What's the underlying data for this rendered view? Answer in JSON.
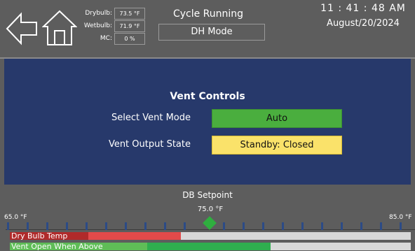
{
  "header": {
    "drybulb_label": "Drybulb:",
    "drybulb_value": "73.5 °F",
    "wetbulb_label": "Wetbulb:",
    "wetbulb_value": "71.9 °F",
    "mc_label": "MC:",
    "mc_value": "0 %",
    "status": "Cycle Running",
    "mode": "DH Mode",
    "time": "11 : 41 : 48  AM",
    "date": "August/20/2024",
    "icons": {
      "back": "back-arrow-icon",
      "home": "home-icon"
    }
  },
  "panel": {
    "title": "Vent Controls",
    "vent_mode_label": "Select Vent Mode",
    "vent_mode_value": "Auto",
    "vent_output_label": "Vent Output State",
    "vent_output_value": "Standby: Closed"
  },
  "setpoint": {
    "title": "DB Setpoint",
    "value": "75.0 °F",
    "scale_min": "65.0 °F",
    "scale_max": "85.0 °F",
    "bars": [
      {
        "label": "Dry Bulb Temp",
        "color": "#e24a4a"
      },
      {
        "label": "Vent Open When Above",
        "color": "#2fae4f"
      }
    ]
  },
  "colors": {
    "background": "#5d5d5d",
    "panel": "#27396b",
    "green_button": "#4aae3e",
    "yellow_button": "#fae26a"
  }
}
